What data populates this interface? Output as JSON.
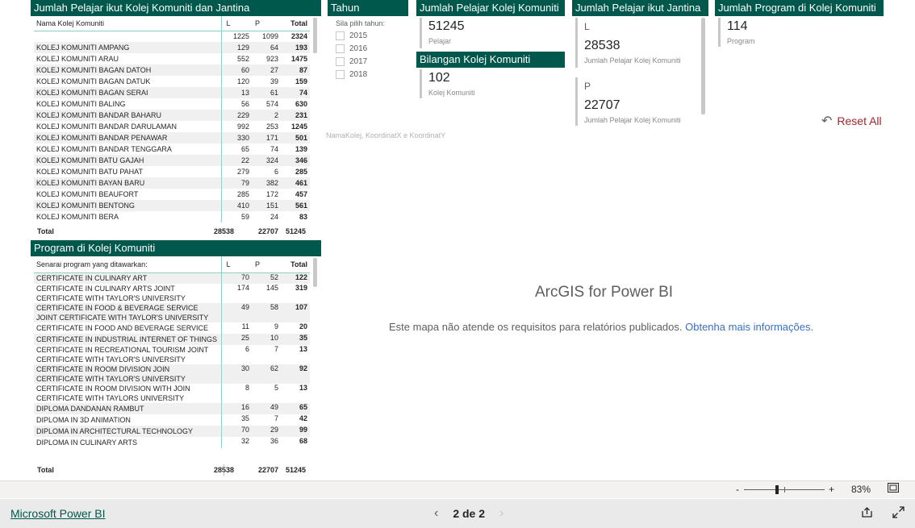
{
  "students_table": {
    "title": "Jumlah Pelajar ikut Kolej Komuniti dan Jantina",
    "columns": [
      "Nama Kolej Komuniti",
      "L",
      "P",
      "Total"
    ],
    "pre_total": [
      "",
      "1225",
      "1099",
      "2324"
    ],
    "rows": [
      [
        "KOLEJ KOMUNITI AMPANG",
        "129",
        "64",
        "193"
      ],
      [
        "KOLEJ KOMUNITI ARAU",
        "552",
        "923",
        "1475"
      ],
      [
        "KOLEJ KOMUNITI BAGAN DATOH",
        "60",
        "27",
        "87"
      ],
      [
        "KOLEJ KOMUNITI BAGAN DATUK",
        "120",
        "39",
        "159"
      ],
      [
        "KOLEJ KOMUNITI BAGAN SERAI",
        "13",
        "61",
        "74"
      ],
      [
        "KOLEJ KOMUNITI BALING",
        "56",
        "574",
        "630"
      ],
      [
        "KOLEJ KOMUNITI BANDAR BAHARU",
        "229",
        "2",
        "231"
      ],
      [
        "KOLEJ KOMUNITI BANDAR DARULAMAN",
        "992",
        "253",
        "1245"
      ],
      [
        "KOLEJ KOMUNITI BANDAR PENAWAR",
        "330",
        "171",
        "501"
      ],
      [
        "KOLEJ KOMUNITI BANDAR TENGGARA",
        "65",
        "74",
        "139"
      ],
      [
        "KOLEJ KOMUNITI BATU GAJAH",
        "22",
        "324",
        "346"
      ],
      [
        "KOLEJ KOMUNITI BATU PAHAT",
        "279",
        "6",
        "285"
      ],
      [
        "KOLEJ KOMUNITI BAYAN BARU",
        "79",
        "382",
        "461"
      ],
      [
        "KOLEJ KOMUNITI BEAUFORT",
        "285",
        "172",
        "457"
      ],
      [
        "KOLEJ KOMUNITI BENTONG",
        "410",
        "151",
        "561"
      ],
      [
        "KOLEJ KOMUNITI BERA",
        "59",
        "24",
        "83"
      ]
    ],
    "total": [
      "Total",
      "28538",
      "22707",
      "51245"
    ]
  },
  "programs_table": {
    "title": "Program di Kolej Komuniti",
    "columns": [
      "Senarai program yang ditawarkan:",
      "L",
      "P",
      "Total"
    ],
    "rows": [
      [
        "CERTIFICATE IN CULINARY ART",
        "70",
        "52",
        "122"
      ],
      [
        "CERTIFICATE IN CULINARY ARTS JOINT CERTIFICATE WITH TAYLOR'S UNIVERSITY",
        "174",
        "145",
        "319"
      ],
      [
        "CERTIFICATE IN FOOD & BEVERAGE SERVICE JOINT CERTIFICATE WITH TAYLOR'S UNIVERSITY",
        "49",
        "58",
        "107"
      ],
      [
        "CERTIFICATE IN FOOD AND BEVERAGE SERVICE",
        "11",
        "9",
        "20"
      ],
      [
        "CERTIFICATE IN INDUSTRIAL INTERNET OF THINGS",
        "25",
        "10",
        "35"
      ],
      [
        "CERTIFICATE IN RECREATIONAL TOURISM JOINT CERTIFICATE WITH TAYLOR'S UNIVERSITY",
        "6",
        "7",
        "13"
      ],
      [
        "CERTIFICATE IN ROOM DIVISION JOIN CERTIFICATE WITH TAYLOR'S UNIVERSITY",
        "30",
        "62",
        "92"
      ],
      [
        "CERTIFICATE IN ROOM DIVISION WITH JOIN CERTIFICATE WITH TAYLORS UNIVERSITY",
        "8",
        "5",
        "13"
      ],
      [
        "DIPLOMA DANDANAN RAMBUT",
        "16",
        "49",
        "65"
      ],
      [
        "DIPLOMA IN 3D ANIMATION",
        "35",
        "7",
        "42"
      ],
      [
        "DIPLOMA IN ARCHITECTURAL TECHNOLOGY",
        "70",
        "29",
        "99"
      ],
      [
        "DIPLOMA IN CULINARY ARTS",
        "32",
        "36",
        "68"
      ]
    ],
    "total": [
      "Total",
      "28538",
      "22707",
      "51245"
    ]
  },
  "year_slicer": {
    "title": "Tahun",
    "hint": "Sila pilih tahun:",
    "options": [
      "2015",
      "2016",
      "2017",
      "2018"
    ]
  },
  "students_card": {
    "title": "Jumlah Pelajar Kolej Komuniti",
    "value": "51245",
    "label": "Pelajar"
  },
  "colleges_card": {
    "title": "Bilangan Kolej Komuniti",
    "value": "102",
    "label": "Kolej Komuniti"
  },
  "gender_card": {
    "title": "Jumlah Pelajar ikut Jantina",
    "l_head": "L",
    "l_value": "28538",
    "l_label": "Jumlah Pelajar Kolej Komuniti",
    "p_head": "P",
    "p_value": "22707",
    "p_label": "Jumlah Pelajar Kolej Komuniti"
  },
  "programs_card": {
    "title": "Jumlah Program di Kolej Komuniti",
    "value": "114",
    "label": "Program"
  },
  "reset": {
    "label": "Reset All",
    "icon": "undo-icon"
  },
  "map": {
    "field_note": "NamaKolej, KoordinatX e KoordinatY",
    "title": "ArcGIS for Power BI",
    "message": "Este mapa não atende os requisitos para relatórios publicados.",
    "link": "Obtenha mais informações."
  },
  "zoom": {
    "minus": "-",
    "plus": "+",
    "level": "83%",
    "level_pct": 83
  },
  "footer": {
    "brand": "Microsoft Power BI",
    "page": "2 de 2",
    "prev_icon": "chevron-left-icon",
    "next_icon": "chevron-right-icon",
    "share_icon": "share-icon",
    "fullscreen_icon": "expand-icon",
    "fit_icon": "fit-page-icon"
  },
  "colors": {
    "header": "#00574b",
    "link": "#3b6fc4",
    "reset": "#a4262c"
  }
}
